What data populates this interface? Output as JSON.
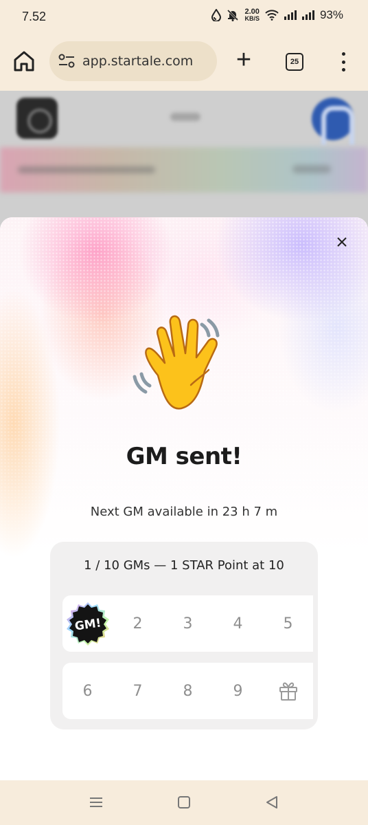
{
  "status_bar": {
    "time": "7.52",
    "net_speed_value": "2.00",
    "net_speed_unit": "KB/S",
    "battery": "93%",
    "icons": [
      "water-drop-icon",
      "bell-off-icon",
      "wifi-icon",
      "signal-icon",
      "signal-icon"
    ]
  },
  "browser": {
    "url": "app.startale.com",
    "tab_count": "25",
    "icons": [
      "home-icon",
      "site-settings-icon",
      "new-tab-icon",
      "menu-icon"
    ]
  },
  "modal": {
    "title": "GM sent!",
    "next_gm_text": "Next GM available in 23 h 7 m",
    "emoji": "waving-hand-emoji",
    "close_icon": "close-icon",
    "progress": {
      "title": "1 / 10 GMs — 1 STAR Point at 10",
      "current": 1,
      "total": 10,
      "badge_label": "GM!",
      "days_row1": [
        "2",
        "3",
        "4",
        "5"
      ],
      "days_row2": [
        "6",
        "7",
        "8",
        "9"
      ],
      "reward_icon": "gift-icon"
    }
  },
  "nav_bar": {
    "icons": [
      "recent-apps-icon",
      "home-icon",
      "back-icon"
    ]
  },
  "colors": {
    "chrome_bg": "#f7ecdc",
    "url_pill": "#ede0c9",
    "card_bg": "#f1f0f0",
    "muted_number": "#8f8f8f"
  }
}
